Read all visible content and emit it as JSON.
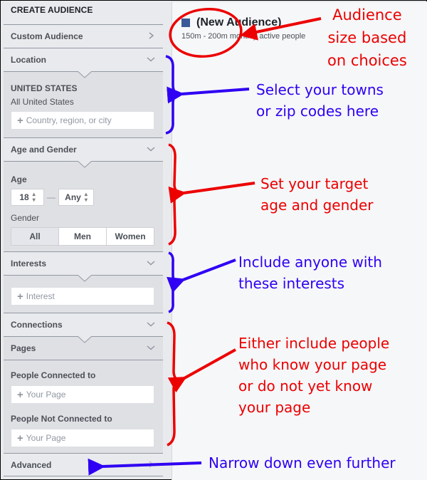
{
  "sidebar": {
    "title": "CREATE AUDIENCE",
    "custom_audience": "Custom Audience",
    "location": {
      "header": "Location",
      "country": "UNITED STATES",
      "scope": "All United States",
      "input_placeholder": "Country, region, or city"
    },
    "age_gender": {
      "header": "Age and Gender",
      "age_label": "Age",
      "age_min": "18",
      "age_separator": "—",
      "age_max": "Any",
      "gender_label": "Gender",
      "gender_options": [
        "All",
        "Men",
        "Women"
      ],
      "gender_selected": "All"
    },
    "interests": {
      "header": "Interests",
      "input_placeholder": "Interest"
    },
    "connections": {
      "header": "Connections"
    },
    "pages": {
      "header": "Pages",
      "connected_label": "People Connected to",
      "connected_placeholder": "Your Page",
      "not_connected_label": "People Not Connected to",
      "not_connected_placeholder": "Your Page"
    },
    "advanced": {
      "header": "Advanced"
    }
  },
  "main": {
    "audience_title": "(New Audience)",
    "audience_size": "150m - 200m monthly active people",
    "audience_icon_color": "#3b5998"
  },
  "annotations": {
    "colors": {
      "red": "#ec0000",
      "blue": "#2f00f3"
    },
    "audience_size": [
      "Audience",
      "size based",
      "on choices"
    ],
    "location": [
      "Select your towns",
      "or zip codes here"
    ],
    "age_gender": [
      "Set your target",
      "age and gender"
    ],
    "interests": [
      "Include anyone with",
      "these interests"
    ],
    "pages": [
      "Either include people",
      "who know your page",
      "or do not yet know",
      "your page"
    ],
    "advanced": [
      "Narrow down even further"
    ]
  }
}
